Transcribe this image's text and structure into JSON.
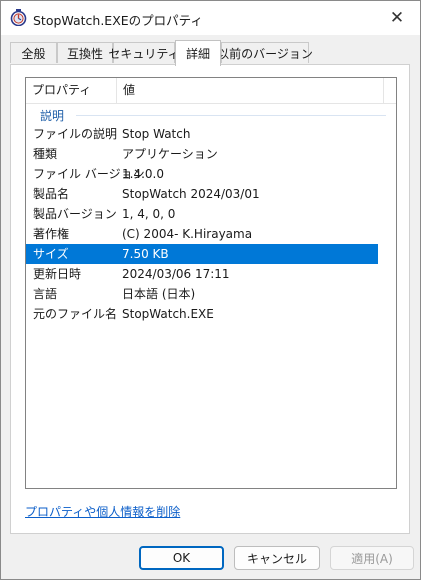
{
  "window": {
    "title": "StopWatch.EXEのプロパティ",
    "close_glyph": "✕",
    "icon": "stopwatch-app-icon"
  },
  "tabs": [
    {
      "label": "全般",
      "active": false
    },
    {
      "label": "互換性",
      "active": false
    },
    {
      "label": "セキュリティ",
      "active": false
    },
    {
      "label": "詳細",
      "active": true
    },
    {
      "label": "以前のバージョン",
      "active": false
    }
  ],
  "details": {
    "columns": {
      "property": "プロパティ",
      "value": "値"
    },
    "group_label": "説明",
    "rows": [
      {
        "key": "ファイルの説明",
        "value": "Stop Watch"
      },
      {
        "key": "種類",
        "value": "アプリケーション"
      },
      {
        "key": "ファイル バージョン",
        "value": "1.4.0.0"
      },
      {
        "key": "製品名",
        "value": "StopWatch 2024/03/01"
      },
      {
        "key": "製品バージョン",
        "value": "1, 4, 0, 0"
      },
      {
        "key": "著作権",
        "value": "(C) 2004- K.Hirayama"
      },
      {
        "key": "サイズ",
        "value": "7.50 KB",
        "selected": true
      },
      {
        "key": "更新日時",
        "value": "2024/03/06 17:11"
      },
      {
        "key": "言語",
        "value": "日本語 (日本)"
      },
      {
        "key": "元のファイル名",
        "value": "StopWatch.EXE"
      }
    ],
    "selected_color": "#0078d7"
  },
  "remove_link": "プロパティや個人情報を削除",
  "buttons": {
    "ok": "OK",
    "cancel": "キャンセル",
    "apply": "適用(A)"
  }
}
